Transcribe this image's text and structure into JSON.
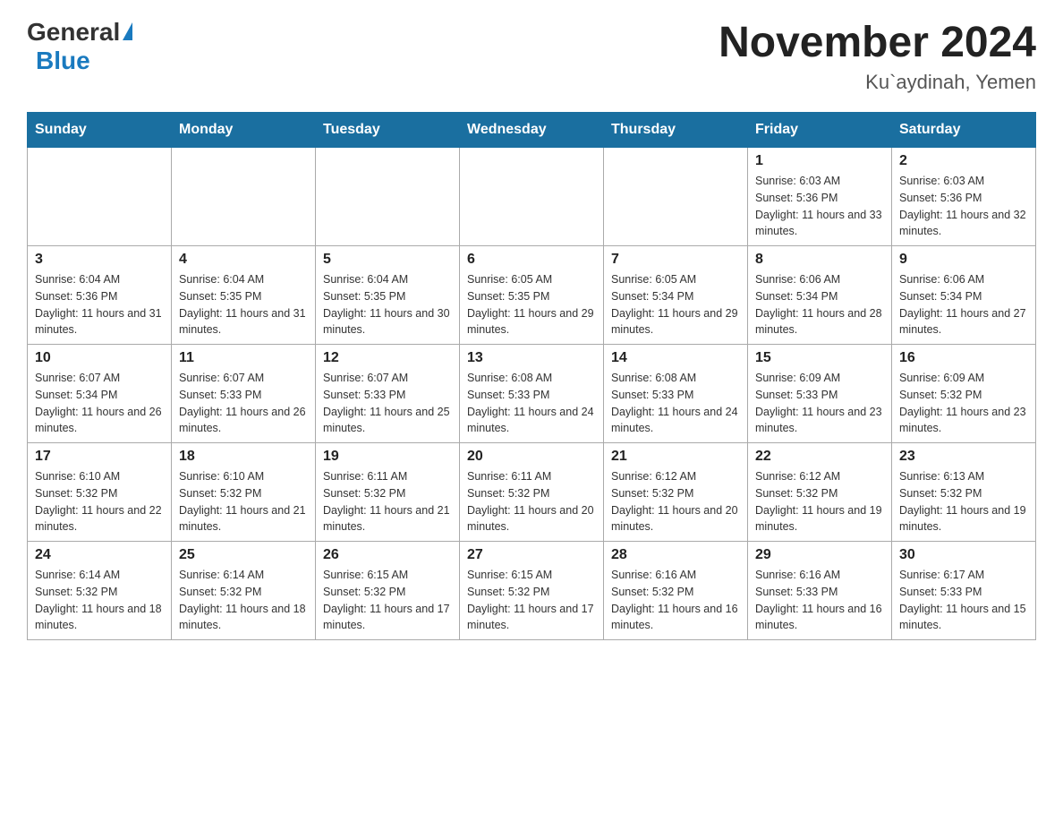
{
  "logo": {
    "general": "General",
    "blue": "Blue"
  },
  "header": {
    "title": "November 2024",
    "location": "Ku`aydinah, Yemen"
  },
  "days_of_week": [
    "Sunday",
    "Monday",
    "Tuesday",
    "Wednesday",
    "Thursday",
    "Friday",
    "Saturday"
  ],
  "weeks": [
    {
      "days": [
        {
          "num": "",
          "info": ""
        },
        {
          "num": "",
          "info": ""
        },
        {
          "num": "",
          "info": ""
        },
        {
          "num": "",
          "info": ""
        },
        {
          "num": "",
          "info": ""
        },
        {
          "num": "1",
          "info": "Sunrise: 6:03 AM\nSunset: 5:36 PM\nDaylight: 11 hours and 33 minutes."
        },
        {
          "num": "2",
          "info": "Sunrise: 6:03 AM\nSunset: 5:36 PM\nDaylight: 11 hours and 32 minutes."
        }
      ]
    },
    {
      "days": [
        {
          "num": "3",
          "info": "Sunrise: 6:04 AM\nSunset: 5:36 PM\nDaylight: 11 hours and 31 minutes."
        },
        {
          "num": "4",
          "info": "Sunrise: 6:04 AM\nSunset: 5:35 PM\nDaylight: 11 hours and 31 minutes."
        },
        {
          "num": "5",
          "info": "Sunrise: 6:04 AM\nSunset: 5:35 PM\nDaylight: 11 hours and 30 minutes."
        },
        {
          "num": "6",
          "info": "Sunrise: 6:05 AM\nSunset: 5:35 PM\nDaylight: 11 hours and 29 minutes."
        },
        {
          "num": "7",
          "info": "Sunrise: 6:05 AM\nSunset: 5:34 PM\nDaylight: 11 hours and 29 minutes."
        },
        {
          "num": "8",
          "info": "Sunrise: 6:06 AM\nSunset: 5:34 PM\nDaylight: 11 hours and 28 minutes."
        },
        {
          "num": "9",
          "info": "Sunrise: 6:06 AM\nSunset: 5:34 PM\nDaylight: 11 hours and 27 minutes."
        }
      ]
    },
    {
      "days": [
        {
          "num": "10",
          "info": "Sunrise: 6:07 AM\nSunset: 5:34 PM\nDaylight: 11 hours and 26 minutes."
        },
        {
          "num": "11",
          "info": "Sunrise: 6:07 AM\nSunset: 5:33 PM\nDaylight: 11 hours and 26 minutes."
        },
        {
          "num": "12",
          "info": "Sunrise: 6:07 AM\nSunset: 5:33 PM\nDaylight: 11 hours and 25 minutes."
        },
        {
          "num": "13",
          "info": "Sunrise: 6:08 AM\nSunset: 5:33 PM\nDaylight: 11 hours and 24 minutes."
        },
        {
          "num": "14",
          "info": "Sunrise: 6:08 AM\nSunset: 5:33 PM\nDaylight: 11 hours and 24 minutes."
        },
        {
          "num": "15",
          "info": "Sunrise: 6:09 AM\nSunset: 5:33 PM\nDaylight: 11 hours and 23 minutes."
        },
        {
          "num": "16",
          "info": "Sunrise: 6:09 AM\nSunset: 5:32 PM\nDaylight: 11 hours and 23 minutes."
        }
      ]
    },
    {
      "days": [
        {
          "num": "17",
          "info": "Sunrise: 6:10 AM\nSunset: 5:32 PM\nDaylight: 11 hours and 22 minutes."
        },
        {
          "num": "18",
          "info": "Sunrise: 6:10 AM\nSunset: 5:32 PM\nDaylight: 11 hours and 21 minutes."
        },
        {
          "num": "19",
          "info": "Sunrise: 6:11 AM\nSunset: 5:32 PM\nDaylight: 11 hours and 21 minutes."
        },
        {
          "num": "20",
          "info": "Sunrise: 6:11 AM\nSunset: 5:32 PM\nDaylight: 11 hours and 20 minutes."
        },
        {
          "num": "21",
          "info": "Sunrise: 6:12 AM\nSunset: 5:32 PM\nDaylight: 11 hours and 20 minutes."
        },
        {
          "num": "22",
          "info": "Sunrise: 6:12 AM\nSunset: 5:32 PM\nDaylight: 11 hours and 19 minutes."
        },
        {
          "num": "23",
          "info": "Sunrise: 6:13 AM\nSunset: 5:32 PM\nDaylight: 11 hours and 19 minutes."
        }
      ]
    },
    {
      "days": [
        {
          "num": "24",
          "info": "Sunrise: 6:14 AM\nSunset: 5:32 PM\nDaylight: 11 hours and 18 minutes."
        },
        {
          "num": "25",
          "info": "Sunrise: 6:14 AM\nSunset: 5:32 PM\nDaylight: 11 hours and 18 minutes."
        },
        {
          "num": "26",
          "info": "Sunrise: 6:15 AM\nSunset: 5:32 PM\nDaylight: 11 hours and 17 minutes."
        },
        {
          "num": "27",
          "info": "Sunrise: 6:15 AM\nSunset: 5:32 PM\nDaylight: 11 hours and 17 minutes."
        },
        {
          "num": "28",
          "info": "Sunrise: 6:16 AM\nSunset: 5:32 PM\nDaylight: 11 hours and 16 minutes."
        },
        {
          "num": "29",
          "info": "Sunrise: 6:16 AM\nSunset: 5:33 PM\nDaylight: 11 hours and 16 minutes."
        },
        {
          "num": "30",
          "info": "Sunrise: 6:17 AM\nSunset: 5:33 PM\nDaylight: 11 hours and 15 minutes."
        }
      ]
    }
  ]
}
